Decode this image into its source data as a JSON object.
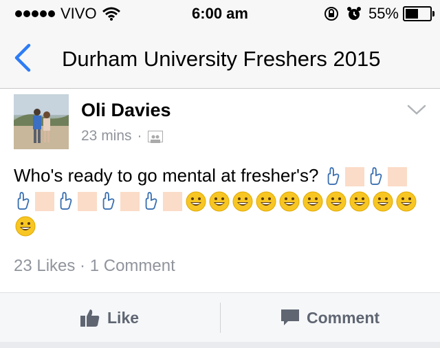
{
  "status_bar": {
    "carrier": "VIVO",
    "time": "6:00 am",
    "battery_percent": "55%",
    "battery_level": 0.55
  },
  "nav": {
    "back_icon": "chevron-left-icon",
    "title": "Durham University Freshers 2015"
  },
  "post": {
    "author": "Oli Davies",
    "time_ago": "23 mins",
    "separator": "·",
    "message_text": "Who's ready to go mental at fresher's?",
    "counts": "23 Likes · 1 Comment"
  },
  "actions": {
    "like_label": "Like",
    "comment_label": "Comment"
  },
  "colors": {
    "accent": "#2d7cf6",
    "muted": "#90949c"
  }
}
